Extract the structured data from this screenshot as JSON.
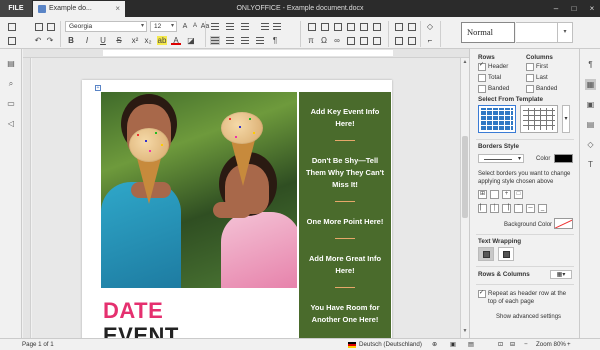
{
  "window": {
    "file_label": "FILE",
    "tab_title": "Example do...",
    "title": "ONLYOFFICE - Example document.docx"
  },
  "toolbar": {
    "font_name": "Georgia",
    "font_size": "12",
    "style_name": "Normal"
  },
  "document": {
    "date_text": "DATE",
    "event_text": "EVENT",
    "green_items": [
      "Add Key Event Info Here!",
      "Don't Be Shy—Tell Them Why They Can't Miss It!",
      "One More Point Here!",
      "Add More Great Info Here!",
      "You Have Room for Another One Here!"
    ]
  },
  "right_panel": {
    "rows_heading": "Rows",
    "columns_heading": "Columns",
    "rows_options": [
      {
        "label": "Header",
        "checked": true
      },
      {
        "label": "Total",
        "checked": false
      },
      {
        "label": "Banded",
        "checked": false
      }
    ],
    "columns_options": [
      {
        "label": "First",
        "checked": false
      },
      {
        "label": "Last",
        "checked": false
      },
      {
        "label": "Banded",
        "checked": false
      }
    ],
    "template_heading": "Select From Template",
    "borders_heading": "Borders Style",
    "color_label": "Color",
    "borders_hint": "Select borders you want to change applying style chosen above",
    "background_label": "Background Color",
    "wrapping_heading": "Text Wrapping",
    "rows_columns_label": "Rows & Columns",
    "repeat_header_label": "Repeat as header row at the top of each page",
    "advanced_label": "Show advanced settings"
  },
  "status": {
    "page": "Page 1 of 1",
    "language": "Deutsch (Deutschland)",
    "zoom": "Zoom 80%"
  },
  "colors": {
    "accent_pink": "#e5306f",
    "green_column": "#4a6b2c",
    "border_color": "#000000"
  }
}
